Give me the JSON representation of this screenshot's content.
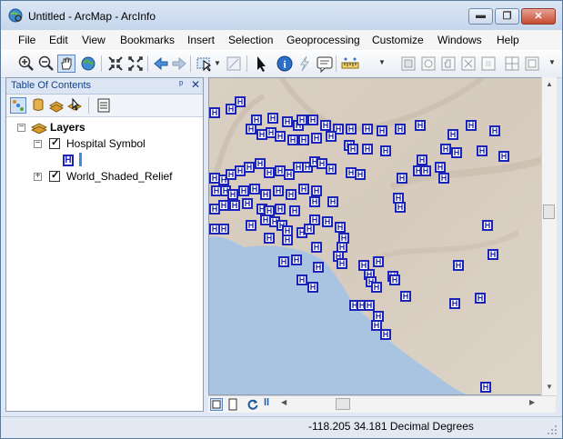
{
  "window": {
    "title": "Untitled - ArcMap - ArcInfo",
    "minimize_label": "▬",
    "restore_label": "❐",
    "close_label": "✕"
  },
  "menu": {
    "items": [
      "File",
      "Edit",
      "View",
      "Bookmarks",
      "Insert",
      "Selection",
      "Geoprocessing",
      "Customize",
      "Windows",
      "Help"
    ]
  },
  "toolbar": {
    "icons": [
      "zoom-in-icon",
      "zoom-out-icon",
      "pan-icon",
      "full-extent-icon",
      "fixed-zoom-in-icon",
      "fixed-zoom-out-icon",
      "back-extent-icon",
      "forward-extent-icon",
      "select-features-icon",
      "clear-selection-icon",
      "select-elements-icon",
      "identify-icon",
      "hyperlink-icon",
      "html-popup-icon",
      "measure-icon"
    ]
  },
  "toc": {
    "title": "Table Of Contents",
    "pin_glyph": "ᵖ",
    "close_glyph": "✕",
    "root_label": "Layers",
    "layers": [
      {
        "label": "Hospital Symbol",
        "checked": true,
        "expanded": true,
        "symbol": "H"
      },
      {
        "label": "World_Shaded_Relief",
        "checked": true,
        "expanded": false
      }
    ],
    "expanded_glyph": "−",
    "collapsed_glyph": "+",
    "check_glyph": "✓"
  },
  "map": {
    "marker_letter": "H",
    "land_color": "#d8cfc3",
    "water_color": "#a9c4e0",
    "marker_color": "#1c23b8"
  },
  "status": {
    "coordinates": "-118.205  34.181 Decimal Degrees"
  }
}
